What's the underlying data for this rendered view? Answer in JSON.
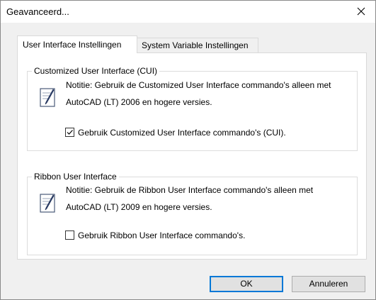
{
  "window": {
    "title": "Geavanceerd..."
  },
  "tabs": [
    {
      "label": "User Interface Instellingen",
      "active": true
    },
    {
      "label": "System Variable Instellingen",
      "active": false
    }
  ],
  "groups": {
    "cui": {
      "title": "Customized User Interface (CUI)",
      "note_line1": "Notitie: Gebruik de Customized User Interface commando's alleen met",
      "note_line2": "AutoCAD (LT) 2006 en hogere versies.",
      "checkbox_label": "Gebruik Customized User Interface commando's (CUI).",
      "checked": true,
      "icon": "note-icon"
    },
    "ribbon": {
      "title": "Ribbon User Interface",
      "note_line1": "Notitie: Gebruik de Ribbon User Interface commando's alleen met",
      "note_line2": "AutoCAD (LT) 2009 en hogere versies.",
      "checkbox_label": "Gebruik Ribbon User Interface commando's.",
      "checked": false,
      "icon": "note-icon"
    }
  },
  "buttons": {
    "ok": "OK",
    "cancel": "Annuleren"
  },
  "colors": {
    "accent": "#0078d7",
    "dialog_bg": "#f0f0f0",
    "panel_bg": "#ffffff"
  }
}
